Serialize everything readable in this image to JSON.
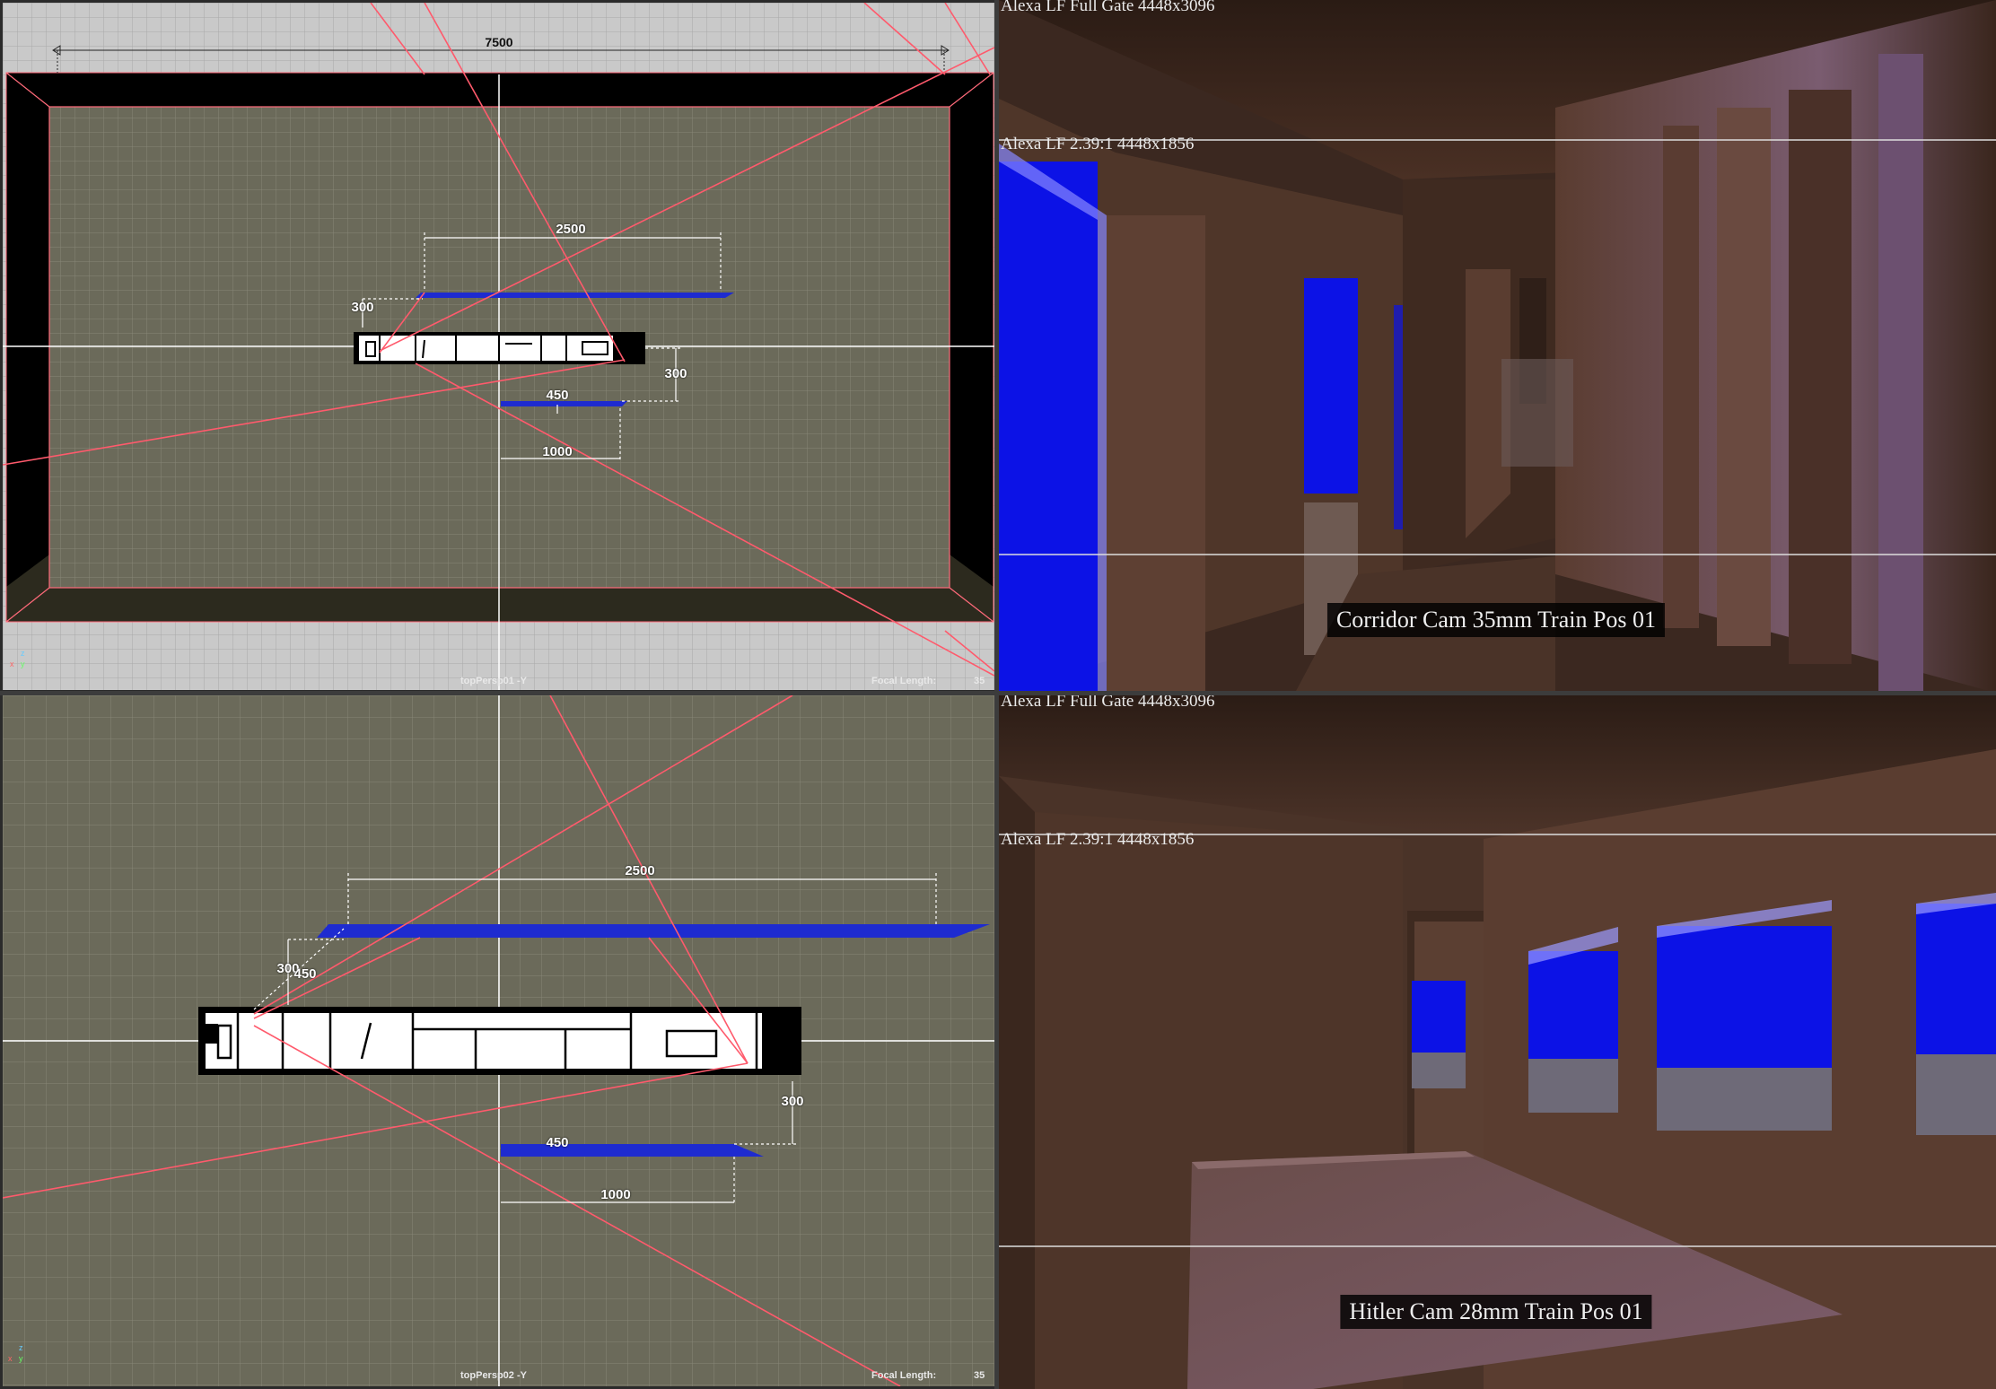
{
  "viewports": {
    "top_left": {
      "camera_name": "topPersp01 -Y",
      "focal_length_label": "Focal Length:",
      "focal_length_value": "35",
      "dimensions": {
        "width_total": "7500",
        "screen_length": "2500",
        "screen_height_left": "300",
        "screen_height_right": "300",
        "offset_near": "450",
        "offset_x": "1000"
      },
      "axis": {
        "z": "z",
        "x": "x",
        "y": "y"
      }
    },
    "bottom_left": {
      "camera_name": "topPersp02 -Y",
      "focal_length_label": "Focal Length:",
      "focal_length_value": "35",
      "dimensions": {
        "screen_length": "2500",
        "screen_height_left": "300",
        "screen_offset_left": "450",
        "screen_height_right": "300",
        "offset_near": "450",
        "offset_x": "1000"
      },
      "axis": {
        "z": "z",
        "x": "x",
        "y": "y"
      }
    },
    "top_right": {
      "gate_full": "Alexa LF Full Gate 4448x3096",
      "gate_crop": "Alexa LF 2.39:1 4448x1856",
      "caption": "Corridor Cam 35mm Train Pos 01"
    },
    "bottom_right": {
      "gate_full": "Alexa LF Full Gate 4448x3096",
      "gate_crop": "Alexa LF 2.39:1 4448x1856",
      "caption": "Hitler Cam 28mm Train Pos 01"
    }
  },
  "colors": {
    "grid_bg": "#6b6a5a",
    "grid_line": "#8c8b7c",
    "outer_grid_bg": "#c8c8c8",
    "frustum_red": "#ff6a7a",
    "screen_blue": "#1e2bd0",
    "room_wall": "#4a3328",
    "window_blue": "#0c12e6"
  }
}
